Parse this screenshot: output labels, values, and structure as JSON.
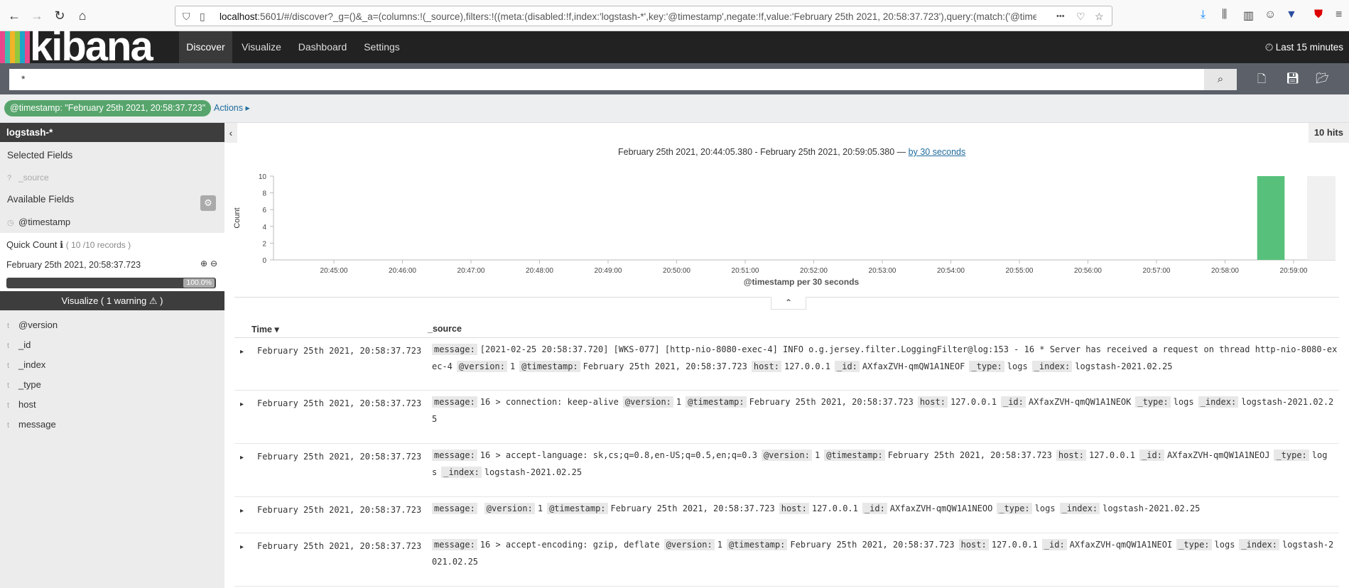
{
  "browser": {
    "url_host": "localhost",
    "url_rest": ":5601/#/discover?_g=()&_a=(columns:!(_source),filters:!((meta:(disabled:!f,index:'logstash-*',key:'@timestamp',negate:!f,value:'February 25th 2021, 20:58:37.723'),query:(match:('@times",
    "more": "•••"
  },
  "kibana": {
    "logo": "kibana",
    "logo_colors": [
      "#e8488b",
      "#3ebeb0",
      "#f0b429",
      "#92c83e",
      "#1ea5c8"
    ],
    "nav": [
      "Discover",
      "Visualize",
      "Dashboard",
      "Settings"
    ],
    "time_label": "Last 15 minutes"
  },
  "search": {
    "query": "*"
  },
  "filterbar": {
    "filter": "@timestamp: \"February 25th 2021, 20:58:37.723\"",
    "actions": "Actions ▸"
  },
  "sidebar": {
    "index": "logstash-*",
    "selected_title": "Selected Fields",
    "selected_fields": [
      "_source"
    ],
    "available_title": "Available Fields",
    "available_top": "@timestamp",
    "quick_count_label": "Quick Count",
    "quick_count_value": "( 10 /10 records )",
    "quick_value": "February 25th 2021, 20:58:37.723",
    "quick_percent": "100.0%",
    "visualize": "Visualize ( 1 warning ⚠ )",
    "fields": [
      "@version",
      "_id",
      "_index",
      "_type",
      "host",
      "message"
    ]
  },
  "main": {
    "hits": "10 hits",
    "range": "February 25th 2021, 20:44:05.380 - February 25th 2021, 20:59:05.380 —",
    "interval": "by 30 seconds",
    "time_header": "Time",
    "source_header": "_source"
  },
  "chart_data": {
    "type": "bar",
    "ylabel": "Count",
    "xlabel": "@timestamp per 30 seconds",
    "ylim": [
      0,
      10
    ],
    "yticks": [
      0,
      2,
      4,
      6,
      8,
      10
    ],
    "xticks": [
      "20:45:00",
      "20:46:00",
      "20:47:00",
      "20:48:00",
      "20:49:00",
      "20:50:00",
      "20:51:00",
      "20:52:00",
      "20:53:00",
      "20:54:00",
      "20:55:00",
      "20:56:00",
      "20:57:00",
      "20:58:00",
      "20:59:00"
    ],
    "bars": [
      {
        "x": "20:58:30",
        "value": 10
      }
    ],
    "bar_color": "#57c17b"
  },
  "rows": [
    {
      "time": "February 25th 2021, 20:58:37.723",
      "fields": [
        [
          "message:",
          "[2021-02-25 20:58:37.720] [WKS-077] [http-nio-8080-exec-4] INFO o.g.jersey.filter.LoggingFilter@log:153 - 16 * Server has received a request on thread http-nio-8080-exec-4"
        ],
        [
          "@version:",
          "1"
        ],
        [
          "@timestamp:",
          "February 25th 2021, 20:58:37.723"
        ],
        [
          "host:",
          "127.0.0.1"
        ],
        [
          "_id:",
          "AXfaxZVH-qmQW1A1NEOF"
        ],
        [
          "_type:",
          "logs"
        ],
        [
          "_index:",
          "logstash-2021.02.25"
        ]
      ]
    },
    {
      "time": "February 25th 2021, 20:58:37.723",
      "fields": [
        [
          "message:",
          "16 > connection: keep-alive"
        ],
        [
          "@version:",
          "1"
        ],
        [
          "@timestamp:",
          "February 25th 2021, 20:58:37.723"
        ],
        [
          "host:",
          "127.0.0.1"
        ],
        [
          "_id:",
          "AXfaxZVH-qmQW1A1NEOK"
        ],
        [
          "_type:",
          "logs"
        ],
        [
          "_index:",
          "logstash-2021.02.25"
        ]
      ]
    },
    {
      "time": "February 25th 2021, 20:58:37.723",
      "fields": [
        [
          "message:",
          "16 > accept-language: sk,cs;q=0.8,en-US;q=0.5,en;q=0.3"
        ],
        [
          "@version:",
          "1"
        ],
        [
          "@timestamp:",
          "February 25th 2021, 20:58:37.723"
        ],
        [
          "host:",
          "127.0.0.1"
        ],
        [
          "_id:",
          "AXfaxZVH-qmQW1A1NEOJ"
        ],
        [
          "_type:",
          "logs"
        ],
        [
          "_index:",
          "logstash-2021.02.25"
        ]
      ]
    },
    {
      "time": "February 25th 2021, 20:58:37.723",
      "fields": [
        [
          "message:",
          ""
        ],
        [
          "@version:",
          "1"
        ],
        [
          "@timestamp:",
          "February 25th 2021, 20:58:37.723"
        ],
        [
          "host:",
          "127.0.0.1"
        ],
        [
          "_id:",
          "AXfaxZVH-qmQW1A1NEOO"
        ],
        [
          "_type:",
          "logs"
        ],
        [
          "_index:",
          "logstash-2021.02.25"
        ]
      ]
    },
    {
      "time": "February 25th 2021, 20:58:37.723",
      "fields": [
        [
          "message:",
          "16 > accept-encoding: gzip, deflate"
        ],
        [
          "@version:",
          "1"
        ],
        [
          "@timestamp:",
          "February 25th 2021, 20:58:37.723"
        ],
        [
          "host:",
          "127.0.0.1"
        ],
        [
          "_id:",
          "AXfaxZVH-qmQW1A1NEOI"
        ],
        [
          "_type:",
          "logs"
        ],
        [
          "_index:",
          "logstash-2021.02.25"
        ]
      ]
    }
  ]
}
